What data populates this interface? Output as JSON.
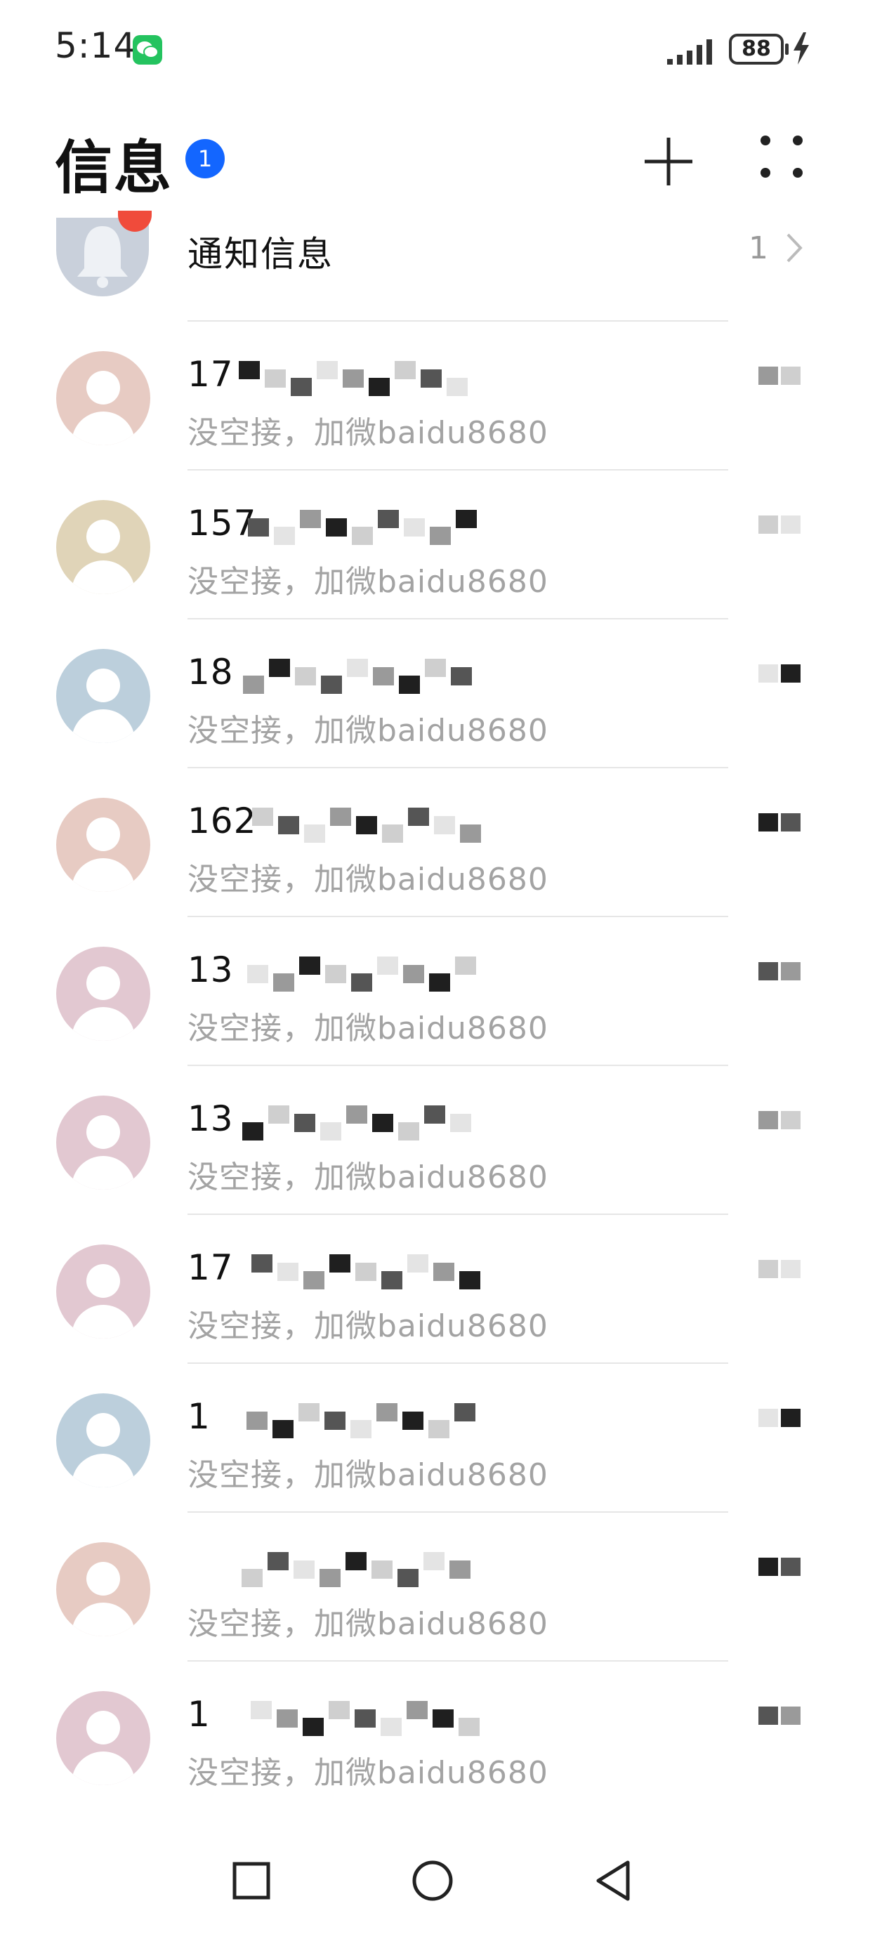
{
  "status_bar": {
    "time": "5:14",
    "battery": "88",
    "app_icon": "wechat-icon",
    "signal_icon": "signal-icon",
    "charging_icon": "charging-bolt-icon"
  },
  "header": {
    "title": "信息",
    "unread_count": "1",
    "add_icon": "plus-icon",
    "more_icon": "more-dots-icon"
  },
  "notification_row": {
    "title": "通知信息",
    "count": "1",
    "icon": "bell-icon"
  },
  "conversations": [
    {
      "sender": "17",
      "preview": "没空接，加微baidu8680",
      "avatar_color": "#e7cbc3"
    },
    {
      "sender": "157",
      "preview": "没空接，加微baidu8680",
      "avatar_color": "#e0d4b8"
    },
    {
      "sender": "18",
      "preview": "没空接，加微baidu8680",
      "avatar_color": "#bccfdc"
    },
    {
      "sender": "162",
      "preview": "没空接，加微baidu8680",
      "avatar_color": "#e7cbc3"
    },
    {
      "sender": "13",
      "preview": "没空接，加微baidu8680",
      "avatar_color": "#e2c8d1"
    },
    {
      "sender": "13",
      "preview": "没空接，加微baidu8680",
      "avatar_color": "#e2c8d1"
    },
    {
      "sender": "17",
      "preview": "没空接，加微baidu8680",
      "avatar_color": "#e2c8d1"
    },
    {
      "sender": "1",
      "preview": "没空接，加微baidu8680",
      "avatar_color": "#bccfdc"
    },
    {
      "sender": "",
      "preview": "没空接，加微baidu8680",
      "avatar_color": "#e7cbc3"
    },
    {
      "sender": "1",
      "preview": "没空接，加微baidu8680",
      "avatar_color": "#e2c8d1"
    }
  ],
  "nav_bar": {
    "recents_icon": "square-recents-icon",
    "home_icon": "circle-home-icon",
    "back_icon": "triangle-back-icon"
  },
  "colors": {
    "accent_badge": "#1366ff",
    "notification_dot": "#f04b3b",
    "preview_text": "#a3a3a3",
    "divider": "#e6e6e6"
  }
}
